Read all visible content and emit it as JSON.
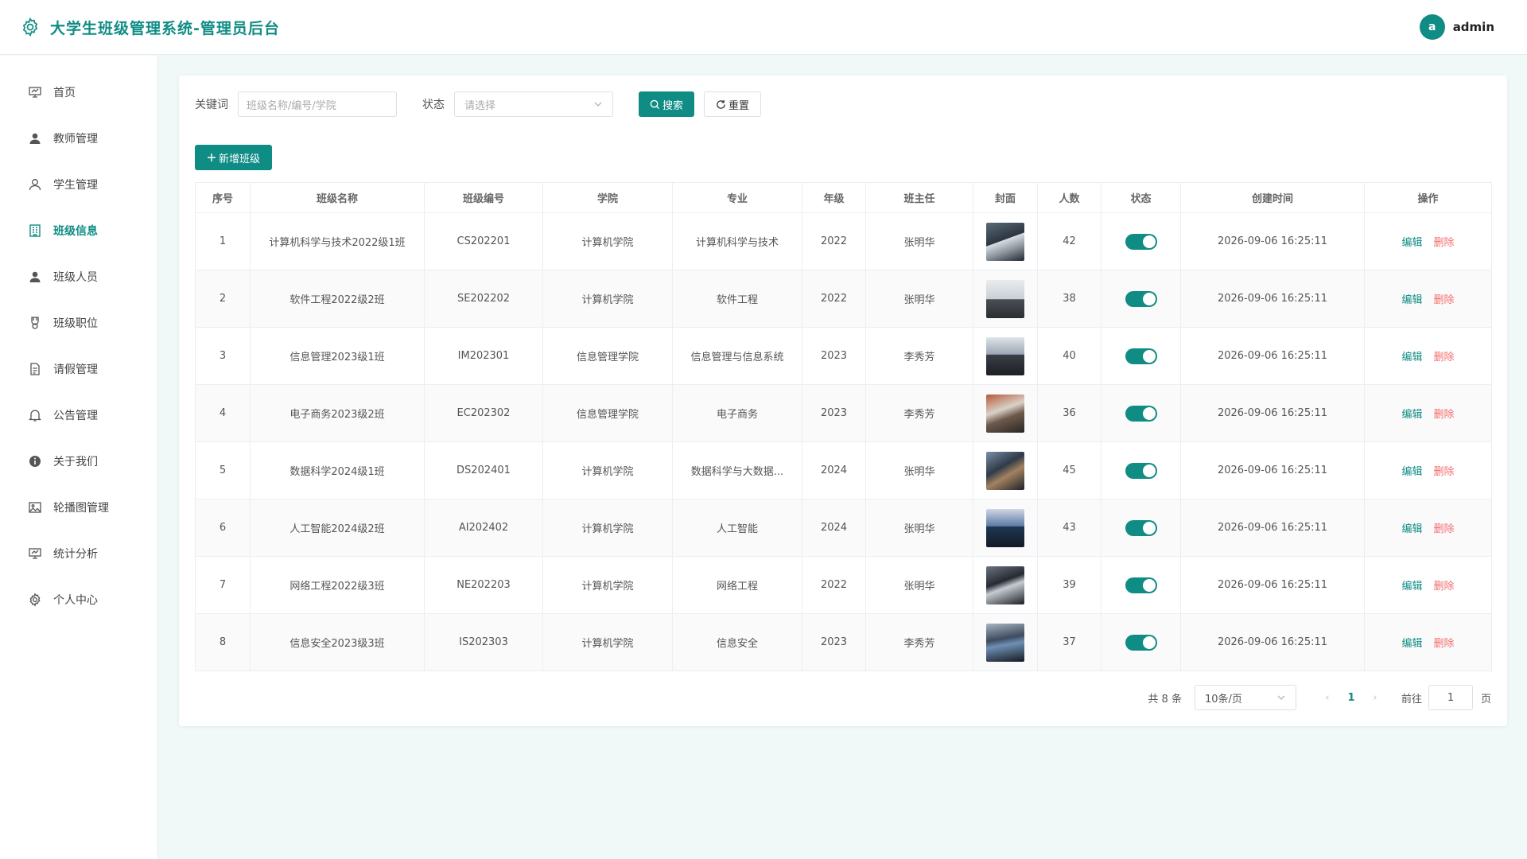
{
  "header": {
    "title": "大学生班级管理系统-管理员后台",
    "avatar_letter": "a",
    "username": "admin"
  },
  "sidebar": {
    "items": [
      {
        "label": "首页",
        "icon": "monitor-icon"
      },
      {
        "label": "教师管理",
        "icon": "user-filled-icon"
      },
      {
        "label": "学生管理",
        "icon": "user-outline-icon"
      },
      {
        "label": "班级信息",
        "icon": "building-icon",
        "active": true
      },
      {
        "label": "班级人员",
        "icon": "user-filled-icon"
      },
      {
        "label": "班级职位",
        "icon": "medal-icon"
      },
      {
        "label": "请假管理",
        "icon": "document-icon"
      },
      {
        "label": "公告管理",
        "icon": "bell-icon"
      },
      {
        "label": "关于我们",
        "icon": "info-icon"
      },
      {
        "label": "轮播图管理",
        "icon": "picture-icon"
      },
      {
        "label": "统计分析",
        "icon": "monitor-icon"
      },
      {
        "label": "个人中心",
        "icon": "gear-icon"
      }
    ]
  },
  "search": {
    "keyword_label": "关键词",
    "keyword_placeholder": "班级名称/编号/学院",
    "status_label": "状态",
    "status_placeholder": "请选择",
    "search_button": "搜索",
    "reset_button": "重置"
  },
  "toolbar": {
    "add_button": "新增班级"
  },
  "table": {
    "columns": [
      "序号",
      "班级名称",
      "班级编号",
      "学院",
      "专业",
      "年级",
      "班主任",
      "封面",
      "人数",
      "状态",
      "创建时间",
      "操作"
    ],
    "edit_label": "编辑",
    "delete_label": "删除",
    "rows": [
      {
        "no": "1",
        "name": "计算机科学与技术2022级1班",
        "code": "CS202201",
        "college": "计算机学院",
        "major": "计算机科学与技术",
        "grade": "2022",
        "teacher": "张明华",
        "count": "42",
        "enabled": true,
        "created": "2026-09-06 16:25:11"
      },
      {
        "no": "2",
        "name": "软件工程2022级2班",
        "code": "SE202202",
        "college": "计算机学院",
        "major": "软件工程",
        "grade": "2022",
        "teacher": "张明华",
        "count": "38",
        "enabled": true,
        "created": "2026-09-06 16:25:11"
      },
      {
        "no": "3",
        "name": "信息管理2023级1班",
        "code": "IM202301",
        "college": "信息管理学院",
        "major": "信息管理与信息系统",
        "grade": "2023",
        "teacher": "李秀芳",
        "count": "40",
        "enabled": true,
        "created": "2026-09-06 16:25:11"
      },
      {
        "no": "4",
        "name": "电子商务2023级2班",
        "code": "EC202302",
        "college": "信息管理学院",
        "major": "电子商务",
        "grade": "2023",
        "teacher": "李秀芳",
        "count": "36",
        "enabled": true,
        "created": "2026-09-06 16:25:11"
      },
      {
        "no": "5",
        "name": "数据科学2024级1班",
        "code": "DS202401",
        "college": "计算机学院",
        "major": "数据科学与大数据...",
        "grade": "2024",
        "teacher": "张明华",
        "count": "45",
        "enabled": true,
        "created": "2026-09-06 16:25:11"
      },
      {
        "no": "6",
        "name": "人工智能2024级2班",
        "code": "AI202402",
        "college": "计算机学院",
        "major": "人工智能",
        "grade": "2024",
        "teacher": "张明华",
        "count": "43",
        "enabled": true,
        "created": "2026-09-06 16:25:11"
      },
      {
        "no": "7",
        "name": "网络工程2022级3班",
        "code": "NE202203",
        "college": "计算机学院",
        "major": "网络工程",
        "grade": "2022",
        "teacher": "张明华",
        "count": "39",
        "enabled": true,
        "created": "2026-09-06 16:25:11"
      },
      {
        "no": "8",
        "name": "信息安全2023级3班",
        "code": "IS202303",
        "college": "计算机学院",
        "major": "信息安全",
        "grade": "2023",
        "teacher": "李秀芳",
        "count": "37",
        "enabled": true,
        "created": "2026-09-06 16:25:11"
      }
    ]
  },
  "pagination": {
    "total_text": "共 8 条",
    "page_size": "10条/页",
    "current_page": "1",
    "goto_label": "前往",
    "goto_value": "1",
    "page_unit": "页"
  },
  "colors": {
    "primary": "#0f8c84",
    "danger": "#f56c6c",
    "background": "#f0f9f8"
  }
}
